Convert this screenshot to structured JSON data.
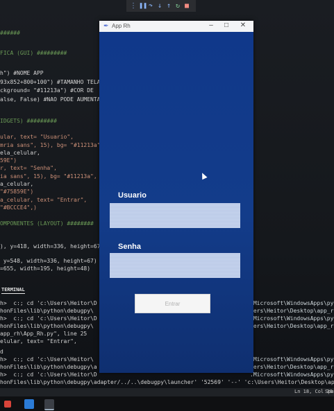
{
  "editor": {
    "code_lines": [
      "######",
      "FICA (GUI) #########",
      "h\") #NOME APP",
      "93x852+800+100\") #TAMANHO TELA",
      "ckground= \"#11213a\") #COR DE",
      "alse, False) #NAO PODE AUMENTAR",
      "IDGETS) #########",
      "ular, text= \"Usuario\",",
      "mria sans\", 15), bg= \"#11213a\"",
      "ela_celular,",
      "59E\")",
      "r, text= \"Senha\",",
      "ia sans\", 15), bg= \"#11213a\",",
      "a_celular,",
      "\"#75859E\")",
      "a_celular, text= \"Entrar\",",
      "\"#BCCCE4\",)",
      "OMPONENTES (LAYOUT) ########",
      "), y=418, width=336, height=67",
      " y=548, width=336, height=67)",
      "=655, width=195, height=48)"
    ],
    "terminal_tab": "TERMINAL",
    "terminal_lines": [
      "h>  c:; cd 'c:\\Users\\Heitor\\D",
      "honFiles\\lib\\python\\debugpy\\",
      "h>  c:; cd 'c:\\Users\\Heitor\\D",
      "honFiles\\lib\\python\\debugpy\\",
      "app_rh\\App_Rh.py\", line 25",
      "elular, text= \"Entrar\",",
      "d",
      "h>  c:; cd 'c:\\Users\\Heitor\\",
      "honFiles\\lib\\python\\debugpy\\a",
      "h>  c:; cd 'c:\\Users\\Heitor\\D",
      "honFiles\\lib\\python\\debugpy\\adapter/../..\\debugpy\\launcher' '52569' '--' 'c:\\Users\\Heitor\\Desktop\\app_rh"
    ],
    "terminal_right_lines": [
      ".Microsoft\\WindowsApps\\pyth",
      "sers\\Heitor\\Desktop\\app_rh",
      ".Microsoft\\WindowsApps\\pyth",
      "sers\\Heitor\\Desktop\\app_rh",
      "",
      "",
      "",
      ".Microsoft\\WindowsApps\\pyth",
      "sers\\Heitor\\Desktop\\app_rh",
      ".Microsoft\\WindowsApps\\pyth"
    ],
    "status": {
      "position": "Ln 18, Col 38",
      "spaces": "Spa"
    }
  },
  "app": {
    "title": "App Rh",
    "user_label": "Usuario",
    "user_value": "",
    "pass_label": "Senha",
    "pass_value": "",
    "enter_label": "Entrar"
  },
  "colors": {
    "app_background": "#133c8a",
    "entry_background": "#BCCCE4",
    "label_color": "#ffffff"
  }
}
